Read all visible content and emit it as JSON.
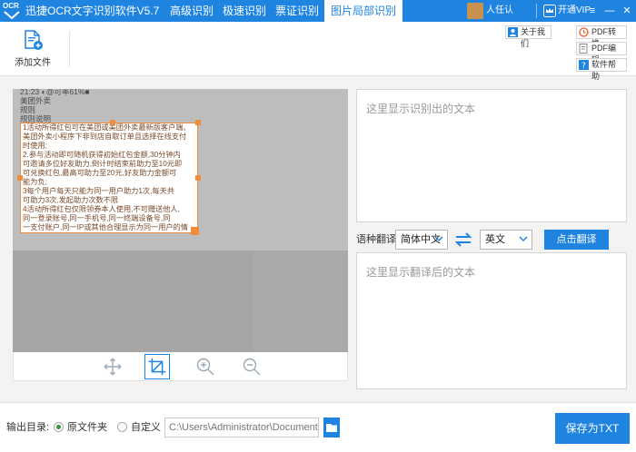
{
  "colors": {
    "accent": "#1f84e0",
    "crop_border": "#f08c3a",
    "radio_checked": "#2a9a3a"
  },
  "titlebar": {
    "logo_text": "OCR",
    "app_title": "迅捷OCR文字识别软件V5.7",
    "tabs": [
      {
        "label": "高级识别",
        "active": false
      },
      {
        "label": "极速识别",
        "active": false
      },
      {
        "label": "票证识别",
        "active": false
      },
      {
        "label": "图片局部识别",
        "active": true
      }
    ],
    "user_name": "人任认",
    "vip_label": "开通VIP",
    "window_buttons": {
      "menu": "≡",
      "minimize": "—",
      "close": "✕"
    }
  },
  "toolbar": {
    "add_file_label": "添加文件",
    "about_label": "关于我们",
    "pdf_convert_label": "PDF转换",
    "pdf_edit_label": "PDF编辑",
    "help_label": "软件帮助"
  },
  "image": {
    "header_lines": [
      "21:23 ◐@可率61%■",
      "美团外卖",
      "规则",
      "规则说明"
    ],
    "crop_lines": [
      "1活动所得红包可在美团或美团外卖最新版客户端、",
      "美团外卖小程序下非到店自取订单且选择在线支付",
      "时使用;",
      "2.参与活动即可随机获得初始红包金额,30分钟内",
      "可邀请多位好友助力,倒计时结束前助力至10元即",
      "可兑换红包,最高可助力至20元,好友助力金额可",
      "能为负;",
      "3每个用户每天只能为同一用户助力1次,每天共",
      "可助力3次,发起助力次数不限",
      "4活动所得红包仅限领券本人使用,不可赠送他人,",
      "同一登录账号,同一手机号,同一终端设备号,同",
      "一支付账户,同一IP或其他合理显示为同一用户的情"
    ]
  },
  "right": {
    "ocr_placeholder": "这里显示识别出的文本",
    "lang_label": "语种翻译:",
    "source_lang": "简体中文",
    "target_lang": "英文",
    "translate_button": "点击翻译",
    "translate_placeholder": "这里显示翻译后的文本"
  },
  "footer": {
    "output_label": "输出目录:",
    "option_original": "原文件夹",
    "option_custom": "自定义",
    "path_value": "C:\\Users\\Administrator\\Documents",
    "save_button": "保存为TXT"
  }
}
